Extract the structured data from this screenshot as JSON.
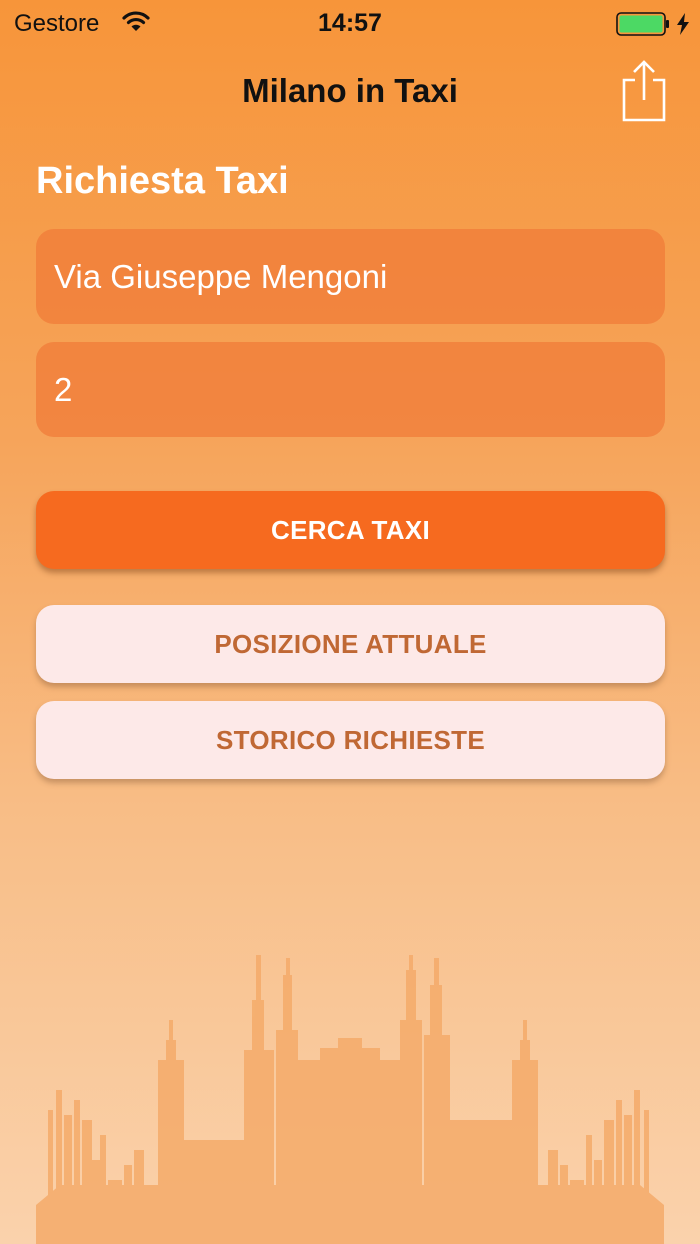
{
  "status_bar": {
    "carrier": "Gestore",
    "time": "14:57",
    "battery_color": "#4cd964"
  },
  "nav": {
    "title": "Milano in Taxi",
    "share_icon": "share-icon"
  },
  "form": {
    "section_title": "Richiesta Taxi",
    "address_value": "Via Giuseppe Mengoni",
    "passengers_value": "2"
  },
  "actions": {
    "search_label": "CERCA TAXI",
    "current_position_label": "POSIZIONE ATTUALE",
    "history_label": "STORICO RICHIESTE"
  },
  "theme": {
    "primary": "#f66a1f",
    "secondary_bg": "#fde9e8",
    "secondary_text": "#c06834"
  }
}
